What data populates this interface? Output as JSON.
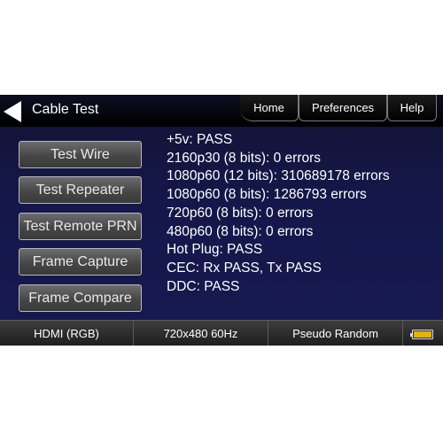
{
  "header": {
    "title": "Cable Test",
    "tabs": [
      "Home",
      "Preferences",
      "Help"
    ]
  },
  "sidebar": {
    "buttons": [
      "Test Wire",
      "Test Repeater",
      "Test Remote PRN",
      "Frame Capture",
      "Frame Compare"
    ]
  },
  "results": [
    "+5v: PASS",
    "2160p30 (8 bits): 0 errors",
    "1080p60 (12 bits): 310689178 errors",
    "1080p60 (8 bits): 1286793 errors",
    "720p60 (8 bits): 0 errors",
    "480p60 (8 bits): 0 errors",
    "Hot Plug: PASS",
    "CEC: Rx PASS, Tx PASS",
    "DDC: PASS"
  ],
  "status": {
    "interface": "HDMI (RGB)",
    "format": "720x480 60Hz",
    "pattern": "Pseudo Random",
    "battery_icon": "battery-icon",
    "battery_color": "#e3b400"
  }
}
